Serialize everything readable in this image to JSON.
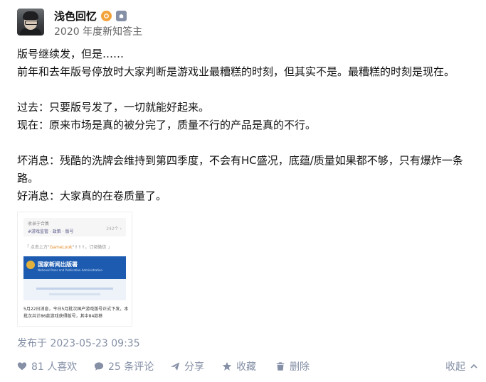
{
  "author": {
    "name": "浅色回忆",
    "subtitle": "2020 年度新知答主",
    "badges": [
      "orange-badge-icon",
      "gray-badge-icon"
    ]
  },
  "content": {
    "paragraphs": [
      "版号继续发，但是……",
      "前年和去年版号停放时大家判断是游戏业最糟糕的时刻，但其实不是。最糟糕的时刻是现在。",
      "",
      "过去：只要版号发了，一切就能好起来。",
      "现在：原来市场是真的被分完了，质量不行的产品是真的不行。",
      "",
      "坏消息：残酷的洗牌会维持到第四季度，不会有HC盛况，底蕴/质量如果都不够，只有爆炸一条路。",
      "好消息：大家真的在卷质量了。"
    ]
  },
  "image_preview": {
    "line1": "收录于合集",
    "line2": "#游戏监管 · 政策 · 版号",
    "count": "242个 ›",
    "line3_pre": "「 点击上方\"",
    "line3_highlight": "GameLook",
    "line3_post": "\"↑↑↑，订阅微信 」",
    "banner_title": "国家新闻出版署",
    "banner_sub": "National Press and Publication Administration",
    "caption": "5月22日消息，今日5月批次国产游戏版号正式下发，本批次共计86款游戏获得版号，其中84款移"
  },
  "meta": {
    "published": "发布于 2023-05-23 09:35"
  },
  "actions": {
    "likes": "81 人喜欢",
    "comments": "25 条评论",
    "share": "分享",
    "favorite": "收藏",
    "delete": "删除",
    "collapse": "收起"
  },
  "colors": {
    "text": "#121212",
    "muted": "#8590a6",
    "badge_orange": "#f2a33a",
    "banner_blue": "#1c5bb0"
  }
}
